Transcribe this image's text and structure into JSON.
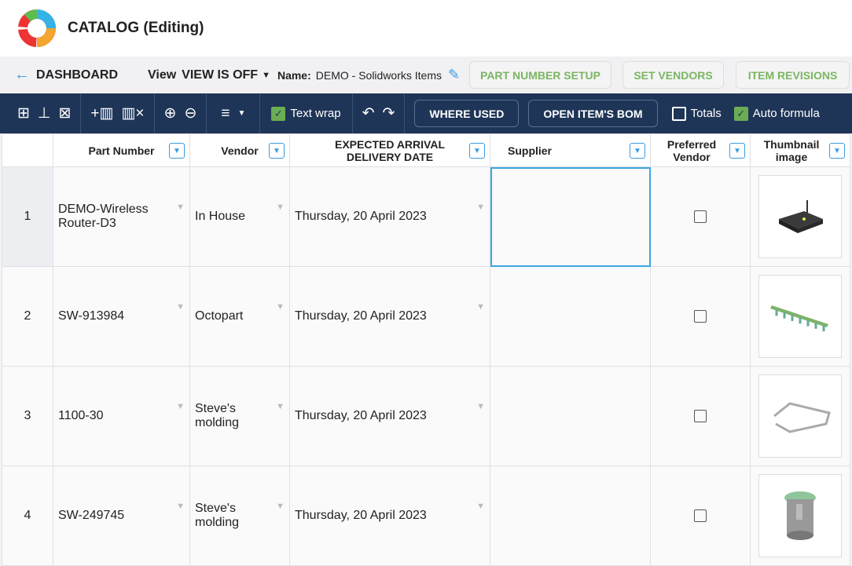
{
  "app": {
    "title": "CATALOG (Editing)"
  },
  "nav": {
    "back_label": "DASHBOARD",
    "view_label": "View",
    "view_value": "VIEW IS OFF",
    "name_label": "Name:",
    "name_value": "DEMO - Solidworks Items",
    "buttons": [
      "PART NUMBER SETUP",
      "SET VENDORS",
      "ITEM REVISIONS"
    ]
  },
  "toolbar": {
    "text_wrap": "Text wrap",
    "text_wrap_checked": true,
    "where_used": "WHERE USED",
    "open_bom": "OPEN ITEM'S BOM",
    "totals": "Totals",
    "totals_checked": false,
    "auto_formula": "Auto formula",
    "auto_formula_checked": true
  },
  "table": {
    "columns": [
      "Part Number",
      "Vendor",
      "EXPECTED ARRIVAL DELIVERY DATE",
      "Supplier",
      "Preferred Vendor",
      "Thumbnail image"
    ],
    "rows": [
      {
        "num": "1",
        "part": "DEMO-Wireless Router-D3",
        "vendor": "In House",
        "date": "Thursday, 20 April 2023",
        "supplier": "",
        "preferred": false
      },
      {
        "num": "2",
        "part": "SW-913984",
        "vendor": "Octopart",
        "date": "Thursday, 20 April 2023",
        "supplier": "",
        "preferred": false
      },
      {
        "num": "3",
        "part": "1100-30",
        "vendor": "Steve's molding",
        "date": "Thursday, 20 April 2023",
        "supplier": "",
        "preferred": false
      },
      {
        "num": "4",
        "part": "SW-249745",
        "vendor": "Steve's molding",
        "date": "Thursday, 20 April 2023",
        "supplier": "",
        "preferred": false
      }
    ]
  }
}
